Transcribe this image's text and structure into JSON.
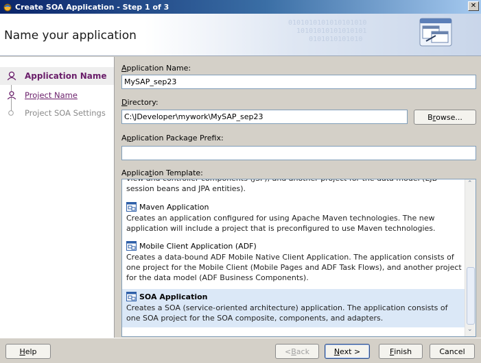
{
  "window": {
    "title": "Create SOA Application - Step 1 of 3",
    "close_glyph": "✕"
  },
  "header": {
    "title": "Name your application",
    "binary_decor": "0101010101010101010\n  10101010101010101\n     0101010101010"
  },
  "nav": {
    "items": [
      {
        "label": "Application Name",
        "state": "active"
      },
      {
        "label": "Project Name",
        "state": "link"
      },
      {
        "label": "Project SOA Settings",
        "state": "disabled"
      }
    ]
  },
  "form": {
    "app_name": {
      "label_pre": "",
      "label_key": "A",
      "label_post": "pplication Name:",
      "value": "MySAP_sep23"
    },
    "directory": {
      "label_pre": "",
      "label_key": "D",
      "label_post": "irectory:",
      "value": "C:\\JDeveloper\\mywork\\MySAP_sep23"
    },
    "browse": {
      "label_pre": "B",
      "label_key": "r",
      "label_post": "owse..."
    },
    "prefix": {
      "label_pre": "A",
      "label_key": "p",
      "label_post": "plication Package Prefix:",
      "value": ""
    },
    "template": {
      "label_pre": "Applica",
      "label_key": "t",
      "label_post": "ion Template:"
    }
  },
  "templates": [
    {
      "name": "",
      "desc": "view and controller components (JSF), and another project for the data model (EJB session beans and JPA entities).",
      "partial": true
    },
    {
      "name": "Maven Application",
      "desc": "Creates an application configured for using Apache Maven technologies. The new application will include a project that is preconfigured to use Maven technologies."
    },
    {
      "name": "Mobile Client Application (ADF)",
      "desc": "Creates a data-bound ADF Mobile Native Client Application.  The application consists of one project for the Mobile Client (Mobile Pages and ADF Task Flows), and another project for the data model (ADF Business Components)."
    },
    {
      "name": "SOA Application",
      "desc": "Creates a SOA (service-oriented architecture) application. The application consists of one SOA project for the SOA composite, components, and adapters.",
      "selected": true
    }
  ],
  "footer": {
    "help": {
      "key": "H",
      "rest": "elp"
    },
    "back": {
      "pre": "< ",
      "key": "B",
      "rest": "ack"
    },
    "next": {
      "key": "N",
      "rest": "ext >"
    },
    "finish": {
      "key": "F",
      "rest": "inish"
    },
    "cancel": "Cancel"
  },
  "colors": {
    "accent": "#6a1e6a",
    "selection": "#dbe8f7",
    "titlebar_start": "#0a246a"
  }
}
